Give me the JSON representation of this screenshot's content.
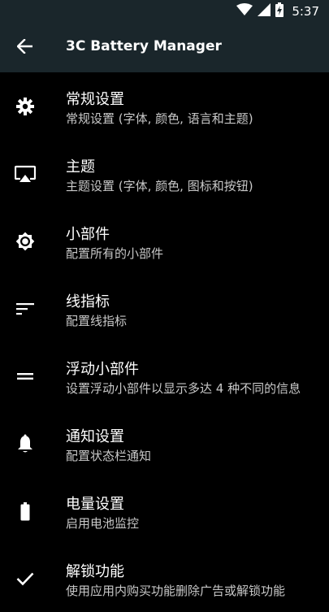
{
  "status_bar": {
    "time": "5:37",
    "icons": [
      "wifi-icon",
      "cell-signal-icon",
      "battery-charging-icon"
    ]
  },
  "app_bar": {
    "title": "3C Battery Manager",
    "back_icon": "arrow-left-icon"
  },
  "settings": [
    {
      "icon": "gear-icon",
      "title": "常规设置",
      "subtitle": "常规设置 (字体, 颜色, 语言和主题)"
    },
    {
      "icon": "cast-screen-icon",
      "title": "主题",
      "subtitle": "主题设置 (字体, 颜色, 图标和按钮)"
    },
    {
      "icon": "brightness-icon",
      "title": "小部件",
      "subtitle": "配置所有的小部件"
    },
    {
      "icon": "sort-lines-icon",
      "title": "线指标",
      "subtitle": "配置线指标"
    },
    {
      "icon": "equals-icon",
      "title": "浮动小部件",
      "subtitle": "设置浮动小部件以显示多达 4 种不同的信息"
    },
    {
      "icon": "bell-icon",
      "title": "通知设置",
      "subtitle": "配置状态栏通知"
    },
    {
      "icon": "battery-icon",
      "title": "电量设置",
      "subtitle": "启用电池监控"
    },
    {
      "icon": "check-icon",
      "title": "解锁功能",
      "subtitle": "使用应用内购买功能删除广告或解锁功能"
    }
  ]
}
